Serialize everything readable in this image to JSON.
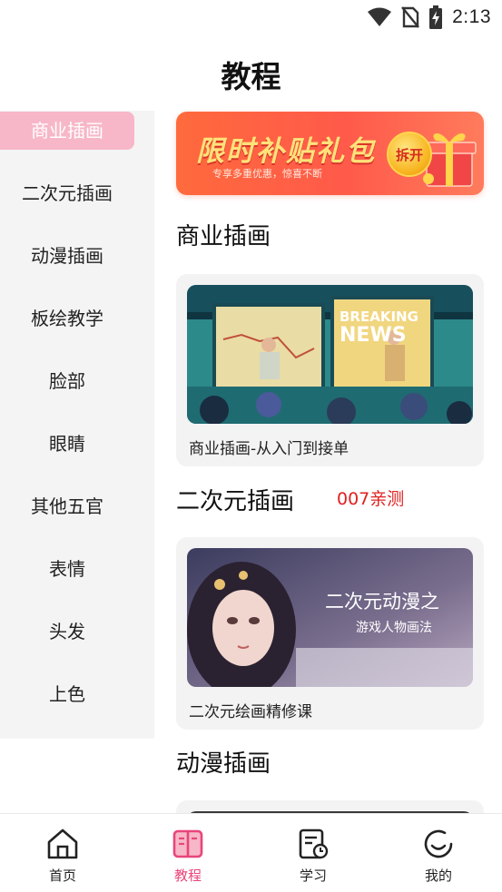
{
  "status_bar": {
    "time": "2:13",
    "icons": [
      "wifi-icon",
      "no-sim-icon",
      "battery-charging-icon"
    ]
  },
  "page": {
    "title": "教程"
  },
  "sidebar": {
    "items": [
      {
        "label": "商业插画",
        "active": true
      },
      {
        "label": "二次元插画",
        "active": false
      },
      {
        "label": "动漫插画",
        "active": false
      },
      {
        "label": "板绘教学",
        "active": false
      },
      {
        "label": "脸部",
        "active": false
      },
      {
        "label": "眼睛",
        "active": false
      },
      {
        "label": "其他五官",
        "active": false
      },
      {
        "label": "表情",
        "active": false
      },
      {
        "label": "头发",
        "active": false
      },
      {
        "label": "上色",
        "active": false
      }
    ]
  },
  "banner": {
    "title": "限时补贴礼包",
    "subtitle": "专享多重优惠，惊喜不断",
    "button": "拆开"
  },
  "sections": [
    {
      "title": "商业插画",
      "tag": "",
      "card": {
        "label": "商业插画-从入门到接单",
        "image_text": [
          "BREAKING",
          "NEWS"
        ]
      }
    },
    {
      "title": "二次元插画",
      "tag": "007亲测",
      "card": {
        "label": "二次元绘画精修课",
        "image_text": [
          "二次元动漫之",
          "游戏人物画法"
        ]
      }
    },
    {
      "title": "动漫插画",
      "tag": ""
    }
  ],
  "bottom_nav": [
    {
      "label": "首页",
      "icon": "home-icon",
      "active": false
    },
    {
      "label": "教程",
      "icon": "book-icon",
      "active": true
    },
    {
      "label": "学习",
      "icon": "study-record-icon",
      "active": false
    },
    {
      "label": "我的",
      "icon": "profile-smile-icon",
      "active": false
    }
  ],
  "colors": {
    "accent": "#e8457a",
    "sidebar_active": "#f7b7c8",
    "tag_red": "#e02020",
    "banner": "#ff5a4a"
  }
}
